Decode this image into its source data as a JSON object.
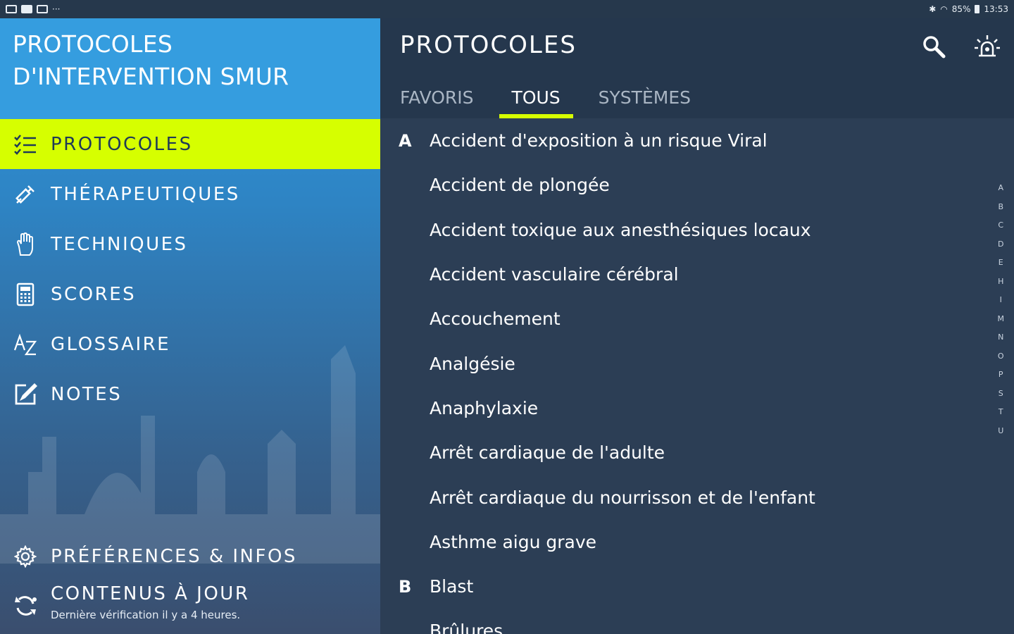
{
  "status_bar": {
    "left_icons": [
      "gallery-icon",
      "media-icon",
      "edit-icon"
    ],
    "dots": "···",
    "right_text": "85%",
    "time": "13:53"
  },
  "drawer": {
    "title": "PROTOCOLES D'INTERVENTION SMUR",
    "items": [
      {
        "label": "PROTOCOLES",
        "icon": "checklist-icon",
        "active": true
      },
      {
        "label": "THÉRAPEUTIQUES",
        "icon": "syringe-icon",
        "active": false
      },
      {
        "label": "TECHNIQUES",
        "icon": "hand-icon",
        "active": false
      },
      {
        "label": "SCORES",
        "icon": "calculator-icon",
        "active": false
      },
      {
        "label": "GLOSSAIRE",
        "icon": "az-icon",
        "active": false
      },
      {
        "label": "NOTES",
        "icon": "note-edit-icon",
        "active": false
      }
    ],
    "preferences_label": "PRÉFÉRENCES & INFOS",
    "update_label": "CONTENUS À JOUR",
    "update_sub": "Dernière vérification il y a 4 heures."
  },
  "main": {
    "title": "PROTOCOLES",
    "actions": [
      "search-icon",
      "alarm-light-icon"
    ],
    "tabs": [
      {
        "label": "FAVORIS",
        "active": false
      },
      {
        "label": "TOUS",
        "active": true
      },
      {
        "label": "SYSTÈMES",
        "active": false
      }
    ],
    "list": [
      {
        "letter": "A",
        "name": "Accident d'exposition à un risque Viral"
      },
      {
        "letter": "",
        "name": "Accident de plongée"
      },
      {
        "letter": "",
        "name": "Accident toxique aux anesthésiques locaux"
      },
      {
        "letter": "",
        "name": "Accident vasculaire cérébral"
      },
      {
        "letter": "",
        "name": "Accouchement"
      },
      {
        "letter": "",
        "name": "Analgésie"
      },
      {
        "letter": "",
        "name": "Anaphylaxie"
      },
      {
        "letter": "",
        "name": "Arrêt cardiaque de l'adulte"
      },
      {
        "letter": "",
        "name": "Arrêt cardiaque du nourrisson et de l'enfant"
      },
      {
        "letter": "",
        "name": "Asthme aigu grave"
      },
      {
        "letter": "B",
        "name": "Blast"
      },
      {
        "letter": "",
        "name": "Brûlures"
      }
    ],
    "alpha_index": [
      "A",
      "B",
      "C",
      "D",
      "E",
      "H",
      "I",
      "M",
      "N",
      "O",
      "P",
      "S",
      "T",
      "U"
    ]
  },
  "colors": {
    "accent": "#d6ff00",
    "drawer_top": "#359ddf",
    "main_bg": "#2c3e55",
    "appbar_bg": "#25374d"
  }
}
